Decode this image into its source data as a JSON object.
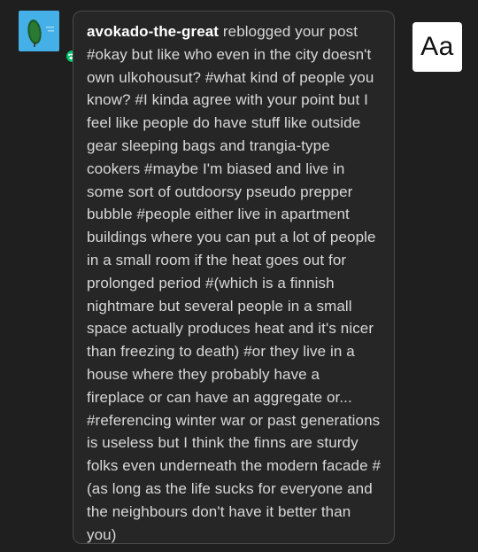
{
  "notification": {
    "username": "avokado-the-great",
    "action": "reblogged your post",
    "tags": "#okay but like who even in the city doesn't own ulkohousut? #what kind of people you know? #I kinda agree with your point but I feel like people do have stuff like outside gear sleeping bags and trangia-type cookers #maybe I'm biased and live in some sort of outdoorsy pseudo prepper bubble #people either live in apartment buildings where you can put a lot of people in a small room if the heat goes out for prolonged period #(which is a finnish nightmare but several people in a small space actually produces heat and it's nicer than freezing to death) #or they live in a house where they probably have a fireplace or can have an aggregate or... #referencing winter war or past generations is useless but I think the finns are sturdy folks even underneath the modern facade #(as long as the life sucks for everyone and the neighbours don't have it better than you)"
  },
  "text_size_button": {
    "label": "Aa"
  },
  "icons": {
    "avatar": "avocado-avatar",
    "badge": "reblog-icon"
  },
  "colors": {
    "background": "#1f1f1f",
    "card_border": "#4a4a4a",
    "avatar_bg": "#45b0e8",
    "reblog_badge": "#00c46a"
  }
}
